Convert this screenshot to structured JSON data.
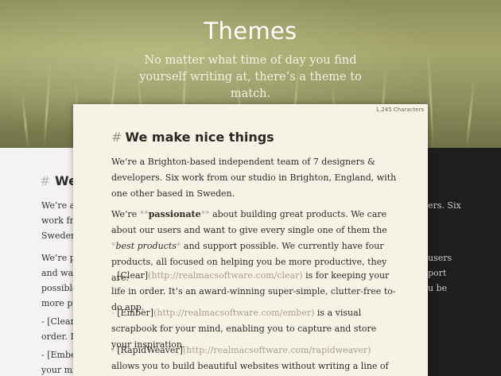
{
  "hero": {
    "title": "Themes",
    "subtitle": "No matter what time of day you find yourself writing at, there’s a theme to match."
  },
  "card": {
    "character_count": "1,245 Characters",
    "heading_marker": "#",
    "heading": "We make nice things",
    "p1": "We’re a Brighton-based independent team of 7 designers & developers. Six work from our studio in Brighton, England, with one other based in Sweden.",
    "p2": {
      "pre": "We’re ",
      "bold_marker_open": "**",
      "bold_text": "passionate",
      "bold_marker_close": "**",
      "mid": " about building great products. We care about our users and want to give every single one of them the ",
      "italic_marker_open": "*",
      "italic_text": "best products",
      "italic_marker_close": "*",
      "post": " and support possible. We currently have four products, all focused on helping you be more productive, they are:"
    },
    "list": [
      {
        "dash": "- ",
        "label": "[Clear]",
        "url": "(http://realmacsoftware.com/clear)",
        "text": " is for keeping your life in order. It’s an award-winning super-simple, clutter-free to-do app."
      },
      {
        "dash": "- ",
        "label": "[Ember]",
        "url": "(http://realmacsoftware.com/ember)",
        "text": " is a visual scrapbook for your mind, enabling you to capture and store your inspiration."
      },
      {
        "dash": "- ",
        "label": "[RapidWeaver]",
        "url": "(http://realmacsoftware.com/rapidweaver)",
        "text": " allows you to build beautiful websites without writing a line of code."
      }
    ]
  },
  "light_panel": {
    "heading_marker": "#",
    "heading": "We",
    "lines": [
      "We’re a B",
      "work fro",
      "Sweden.",
      "We’re pa",
      "and wan",
      "possible.",
      "more pro",
      "- [Clear",
      "order. It",
      "- [Ember",
      "your mi"
    ]
  },
  "dark_panel": {
    "lines": [
      "ers. Six",
      "users",
      "port",
      "u be"
    ]
  }
}
